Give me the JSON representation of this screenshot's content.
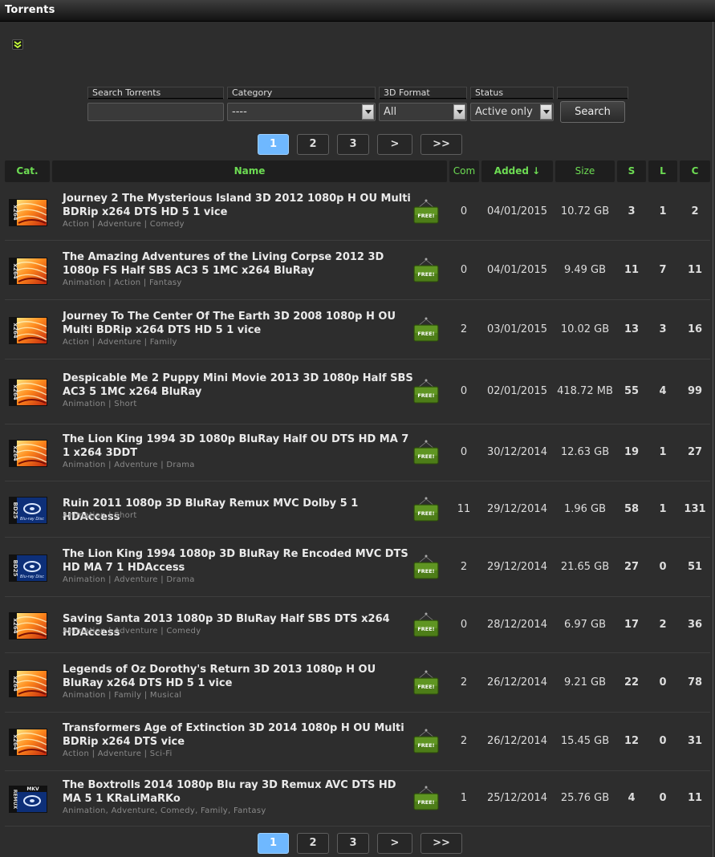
{
  "window": {
    "title": "Torrents"
  },
  "search": {
    "labels": {
      "query": "Search Torrents",
      "category": "Category",
      "format": "3D Format",
      "status": "Status"
    },
    "query_value": "",
    "category_value": "----",
    "format_value": "All",
    "status_value": "Active only",
    "button_label": "Search"
  },
  "pagination": {
    "pages": [
      "1",
      "2",
      "3"
    ],
    "next": ">",
    "last": ">>",
    "current": "1"
  },
  "columns": {
    "cat": "Cat.",
    "name": "Name",
    "com": "Com",
    "added": "Added ↓",
    "size": "Size",
    "s": "S",
    "l": "L",
    "c": "C"
  },
  "free_label": "FREE!",
  "icon_labels": {
    "x264": "x264",
    "bd25": "BD25",
    "remux": "REMUX",
    "mkv": "MKV",
    "bluray": "Blu-ray Disc"
  },
  "torrents": [
    {
      "cat": "x264",
      "name": "Journey 2 The Mysterious Island 3D 2012 1080p H OU Multi BDRip x264 DTS HD 5 1 vice",
      "genres": "Action | Adventure | Comedy",
      "com": "0",
      "added": "04/01/2015",
      "size": "10.72 GB",
      "s": "3",
      "l": "1",
      "c": "2"
    },
    {
      "cat": "x264",
      "name": "The Amazing Adventures of the Living Corpse 2012 3D 1080p FS Half SBS AC3 5 1MC x264 BluRay",
      "genres": "Animation | Action | Fantasy",
      "com": "0",
      "added": "04/01/2015",
      "size": "9.49 GB",
      "s": "11",
      "l": "7",
      "c": "11"
    },
    {
      "cat": "x264",
      "name": "Journey To The Center Of The Earth 3D 2008 1080p H OU Multi BDRip x264 DTS HD 5 1 vice",
      "genres": "Action | Adventure | Family",
      "com": "2",
      "added": "03/01/2015",
      "size": "10.02 GB",
      "s": "13",
      "l": "3",
      "c": "16"
    },
    {
      "cat": "x264",
      "name": "Despicable Me 2 Puppy Mini Movie 2013 3D 1080p Half SBS AC3 5 1MC x264 BluRay",
      "genres": "Animation | Short",
      "com": "0",
      "added": "02/01/2015",
      "size": "418.72 MB",
      "s": "55",
      "l": "4",
      "c": "99"
    },
    {
      "cat": "x264",
      "name": "The Lion King 1994 3D 1080p BluRay Half OU DTS HD MA 7 1 x264 3DDT",
      "genres": "Animation | Adventure | Drama",
      "com": "0",
      "added": "30/12/2014",
      "size": "12.63 GB",
      "s": "19",
      "l": "1",
      "c": "27"
    },
    {
      "cat": "bd25",
      "name": "Ruin 2011 1080p 3D BluRay Remux MVC Dolby 5 1 HDAccess",
      "genres": "Animation | Short",
      "com": "11",
      "added": "29/12/2014",
      "size": "1.96 GB",
      "s": "58",
      "l": "1",
      "c": "131"
    },
    {
      "cat": "bd25",
      "name": "The Lion King 1994 1080p 3D BluRay Re Encoded MVC DTS HD MA 7 1 HDAccess",
      "genres": "Animation | Adventure | Drama",
      "com": "2",
      "added": "29/12/2014",
      "size": "21.65 GB",
      "s": "27",
      "l": "0",
      "c": "51"
    },
    {
      "cat": "x264",
      "name": "Saving Santa 2013 1080p 3D BluRay Half SBS DTS x264 HDAccess",
      "genres": "Animation | Adventure | Comedy",
      "com": "0",
      "added": "28/12/2014",
      "size": "6.97 GB",
      "s": "17",
      "l": "2",
      "c": "36"
    },
    {
      "cat": "x264",
      "name": "Legends of Oz Dorothy's Return 3D 2013 1080p H OU BluRay x264 DTS HD 5 1 vice",
      "genres": "Animation | Family | Musical",
      "com": "2",
      "added": "26/12/2014",
      "size": "9.21 GB",
      "s": "22",
      "l": "0",
      "c": "78"
    },
    {
      "cat": "x264",
      "name": "Transformers Age of Extinction 3D 2014 1080p H OU Multi BDRip x264 DTS vice",
      "genres": "Action | Adventure | Sci-Fi",
      "com": "2",
      "added": "26/12/2014",
      "size": "15.45 GB",
      "s": "12",
      "l": "0",
      "c": "31"
    },
    {
      "cat": "remux",
      "name": "The Boxtrolls 2014 1080p Blu ray 3D Remux AVC DTS HD MA 5 1 KRaLiMaRKo",
      "genres": "Animation, Adventure, Comedy, Family, Fantasy",
      "com": "1",
      "added": "25/12/2014",
      "size": "25.76 GB",
      "s": "4",
      "l": "0",
      "c": "11"
    }
  ],
  "colors": {
    "header_text": "#6ddc53",
    "active_page": "#6fb8ff",
    "free_tag": "#5d8c1e"
  }
}
